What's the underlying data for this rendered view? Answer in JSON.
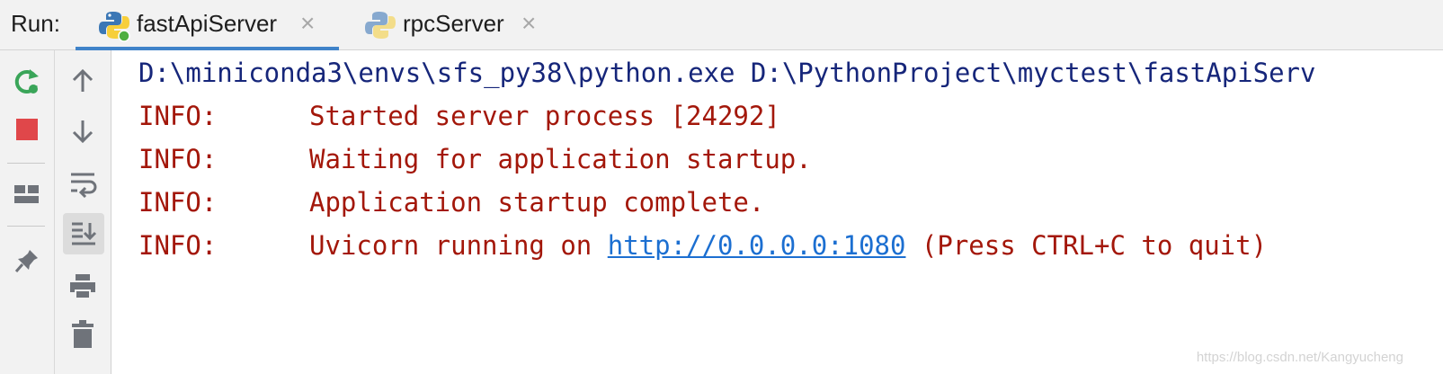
{
  "tool_window": {
    "title": "Run:"
  },
  "tabs": [
    {
      "label": "fastApiServer",
      "close": "×",
      "active": true
    },
    {
      "label": "rpcServer",
      "close": "×",
      "active": false
    }
  ],
  "toolbar_left": [
    {
      "icon": "rerun-icon"
    },
    {
      "icon": "stop-icon"
    },
    {
      "icon": "layout-icon"
    },
    {
      "icon": "pin-icon"
    }
  ],
  "toolbar_right": [
    {
      "icon": "arrow-up-icon"
    },
    {
      "icon": "arrow-down-icon"
    },
    {
      "icon": "soft-wrap-icon"
    },
    {
      "icon": "scroll-to-end-icon",
      "toggled": true
    },
    {
      "icon": "print-icon"
    },
    {
      "icon": "trash-icon"
    }
  ],
  "console": {
    "command": "D:\\miniconda3\\envs\\sfs_py38\\python.exe D:\\PythonProject\\myctest\\fastApiServ",
    "lines": [
      {
        "level": "INFO:",
        "text": "Started server process [24292]"
      },
      {
        "level": "INFO:",
        "text": "Waiting for application startup."
      },
      {
        "level": "INFO:",
        "text": "Application startup complete."
      },
      {
        "level": "INFO:",
        "text_before": "Uvicorn running on ",
        "link": "http://0.0.0.0:1080",
        "text_after": " (Press CTRL+C to quit)"
      }
    ]
  },
  "watermark": "https://blog.csdn.net/Kangyucheng",
  "colors": {
    "command": "#16267a",
    "log": "#a3170a",
    "link": "#1c6fd1",
    "tab_underline": "#4083c9",
    "stop": "#e0474a",
    "rerun": "#3aa559"
  }
}
